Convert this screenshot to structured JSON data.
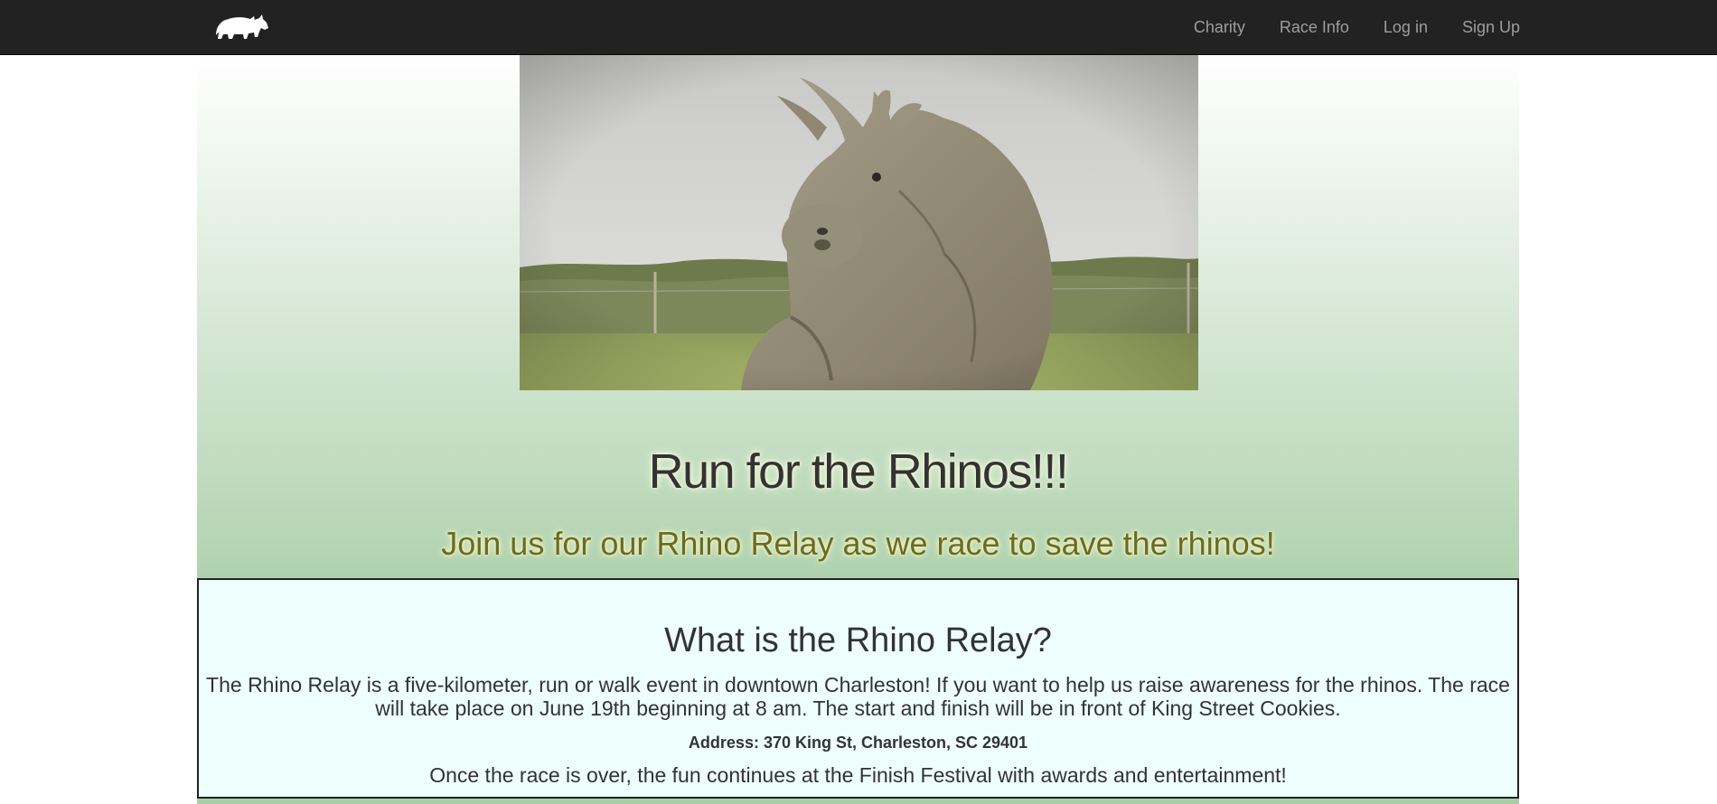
{
  "navbar": {
    "logo_icon": "rhino-logo-icon",
    "links": [
      {
        "label": "Charity"
      },
      {
        "label": "Race Info"
      },
      {
        "label": "Log in"
      },
      {
        "label": "Sign Up"
      }
    ]
  },
  "hero": {
    "image": "rhino-photo"
  },
  "main": {
    "headline": "Run for the Rhinos!!!",
    "subheadline": "Join us for our Rhino Relay as we race to save the rhinos!"
  },
  "info": {
    "title": "What is the Rhino Relay?",
    "description": "The Rhino Relay is a five-kilometer, run or walk event in downtown Charleston! If you want to help us raise awareness for the rhinos. The race will take place on June 19th beginning at 8 am. The start and finish will be in front of King Street Cookies.",
    "address": "Address: 370 King St, Charleston, SC 29401",
    "closing": "Once the race is over, the fun continues at the Finish Festival with awards and entertainment!"
  },
  "colors": {
    "navbar_bg": "#222222",
    "nav_link": "#9d9d9d",
    "subheadline": "#6b6b1f",
    "info_bg": "#eefefd",
    "gradient_bottom": "#a9cea6"
  }
}
